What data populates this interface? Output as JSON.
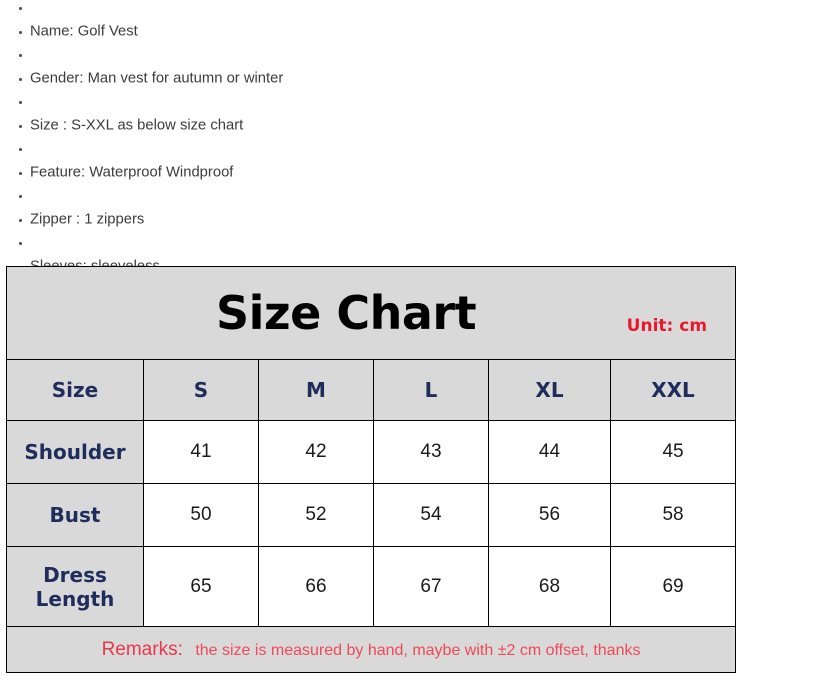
{
  "product_specs": [
    {
      "label": "Name: Golf Vest"
    },
    {
      "label": "Gender: Man vest for autumn or winter"
    },
    {
      "label": "Size : S-XXL as below size chart"
    },
    {
      "label": "Feature: Waterproof Windproof"
    },
    {
      "label": "Zipper : 1 zippers"
    },
    {
      "label": "Sleeves: sleeveless"
    }
  ],
  "size_chart": {
    "title": "Size Chart",
    "unit_note": "Unit: cm",
    "size_label": "Size",
    "columns": [
      "S",
      "M",
      "L",
      "XL",
      "XXL"
    ],
    "rows": [
      {
        "label": "Shoulder",
        "values": [
          "41",
          "42",
          "43",
          "44",
          "45"
        ]
      },
      {
        "label": "Bust",
        "values": [
          "50",
          "52",
          "54",
          "56",
          "58"
        ]
      },
      {
        "label": "Dress Length",
        "values": [
          "65",
          "66",
          "67",
          "68",
          "69"
        ]
      }
    ],
    "remarks_label": "Remarks:",
    "remarks_text": "the size is measured by hand, maybe with ±2 cm offset,  thanks"
  },
  "colors": {
    "header_gray": "#d9d9d9",
    "navy": "#1f2d5c",
    "red": "#e8192c",
    "remarks_red": "#ef4a58",
    "border": "#000000"
  }
}
